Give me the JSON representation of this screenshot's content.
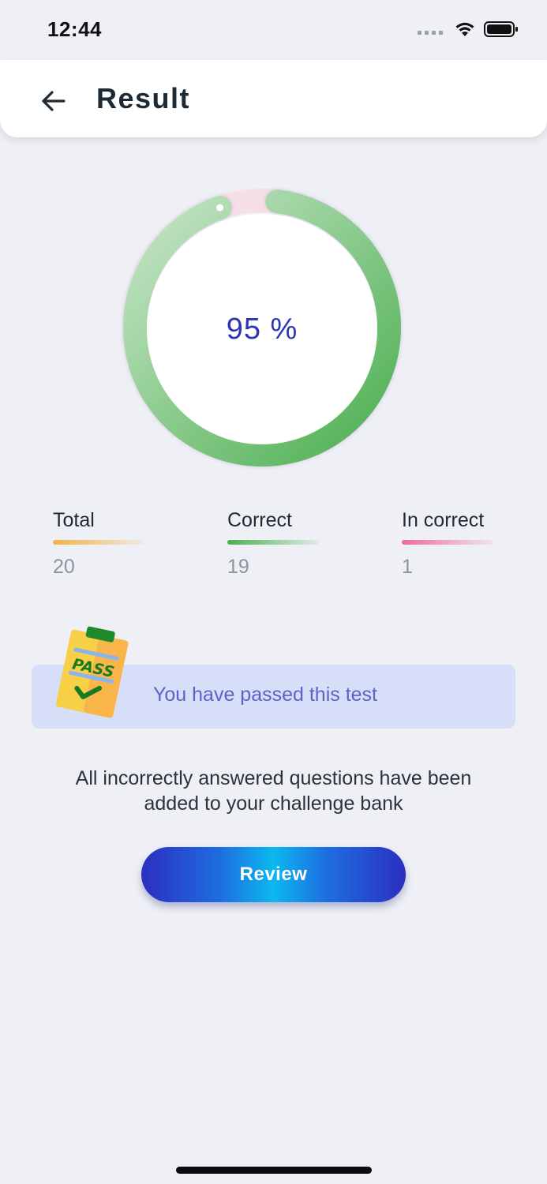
{
  "status_bar": {
    "time": "12:44",
    "icons": [
      "signal-icon",
      "wifi-icon",
      "battery-icon"
    ]
  },
  "header": {
    "back_icon": "arrow-left-icon",
    "title": "Result"
  },
  "score": {
    "display": "95 %",
    "progress_fraction": 0.95,
    "ring_color_start": "#c2e4c4",
    "ring_color_end": "#4caf50"
  },
  "stats": [
    {
      "label": "Total",
      "value": "20",
      "bar_color": "#f0b24a"
    },
    {
      "label": "Correct",
      "value": "19",
      "bar_color": "#4caf50"
    },
    {
      "label": "In correct",
      "value": "1",
      "bar_color": "#ef6b96"
    }
  ],
  "pass_banner": {
    "icon": "pass-clipboard-icon",
    "icon_text": "PASS",
    "message": "You have passed this test"
  },
  "note": "All incorrectly answered questions have been added to your challenge bank",
  "review_button": {
    "label": "Review"
  },
  "colors": {
    "background": "#eff0f6",
    "accent": "#2c35b5",
    "banner": "#d6def8"
  }
}
